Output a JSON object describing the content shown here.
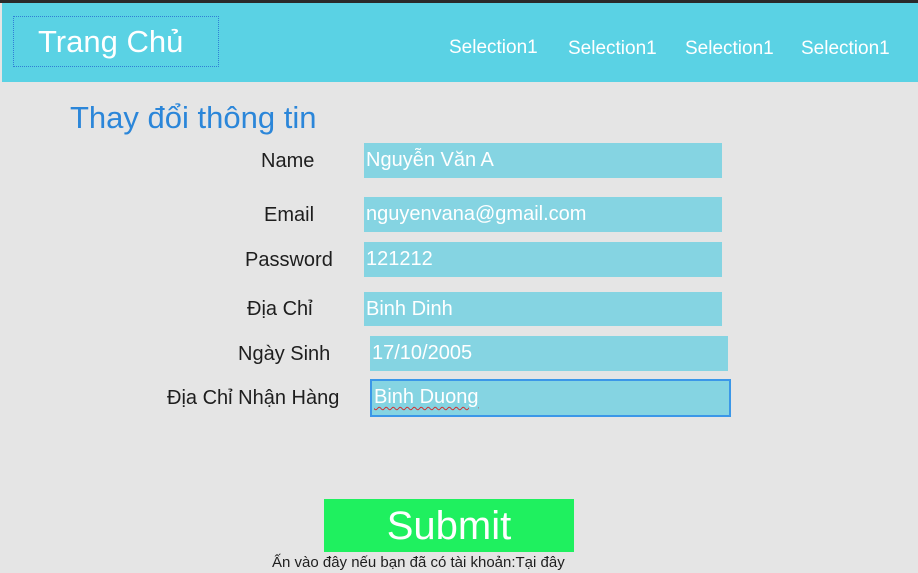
{
  "header": {
    "brand": "Trang Chủ",
    "nav": [
      "Selection1",
      "Selection1",
      "Selection1",
      "Selection1"
    ]
  },
  "form": {
    "title": "Thay đổi thông tin",
    "fields": [
      {
        "label": "Name",
        "value": "Nguyễn Văn A"
      },
      {
        "label": "Email",
        "value": "nguyenvana@gmail.com"
      },
      {
        "label": "Password",
        "value": "121212"
      },
      {
        "label": "Địa Chỉ",
        "value": "Binh Dinh"
      },
      {
        "label": "Ngày Sinh",
        "value": "17/10/2005"
      },
      {
        "label": "Địa Chỉ Nhận Hàng",
        "value": "Binh Duong"
      }
    ],
    "submit_label": "Submit",
    "footer_note": "Ấn vào đây nếu bạn đã có tài khoản:Tại đây"
  },
  "colors": {
    "header_bg": "#5ad2e4",
    "field_bg": "#85d4e2",
    "title": "#2b86d9",
    "submit_bg": "#1ff05f",
    "page_bg": "#e5e5e5"
  }
}
